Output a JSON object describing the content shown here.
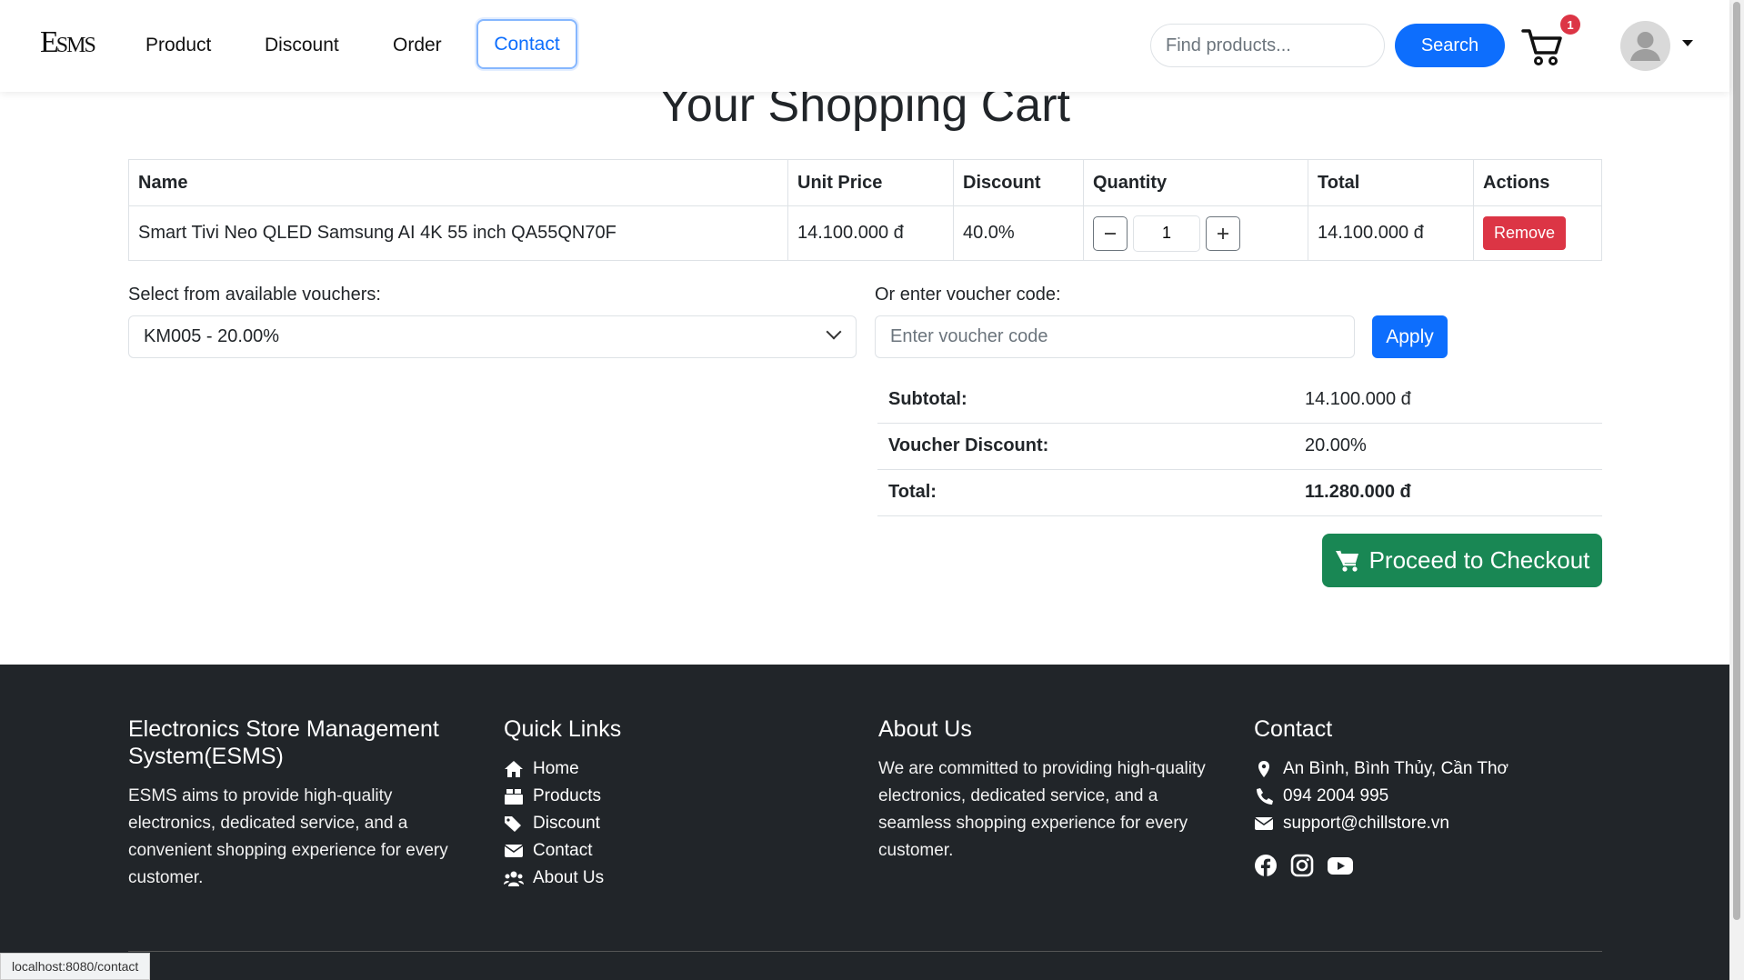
{
  "navbar": {
    "logo": "ESMS",
    "links": [
      "Product",
      "Discount",
      "Order",
      "Contact"
    ],
    "search_placeholder": "Find products...",
    "search_label": "Search",
    "cart_count": "1"
  },
  "cart": {
    "title": "Your Shopping Cart",
    "columns": [
      "Name",
      "Unit Price",
      "Discount",
      "Quantity",
      "Total",
      "Actions"
    ],
    "items": [
      {
        "name": "Smart Tivi Neo QLED Samsung AI 4K 55 inch QA55QN70F",
        "unit_price": "14.100.000 đ",
        "discount": "40.0%",
        "quantity": "1",
        "total": "14.100.000 đ",
        "remove_label": "Remove"
      }
    ]
  },
  "voucher": {
    "select_label": "Select from available vouchers:",
    "selected": "KM005 - 20.00%",
    "code_label": "Or enter voucher code:",
    "code_placeholder": "Enter voucher code",
    "apply_label": "Apply"
  },
  "summary": {
    "subtotal_label": "Subtotal:",
    "subtotal": "14.100.000 đ",
    "voucher_discount_label": "Voucher Discount:",
    "voucher_discount": "20.00%",
    "total_label": "Total:",
    "total": "11.280.000 đ"
  },
  "checkout_label": "Proceed to Checkout",
  "footer": {
    "about_title": "Electronics Store Management System(ESMS)",
    "about_text": "ESMS aims to provide high-quality electronics, dedicated service, and a convenient shopping experience for every customer.",
    "quick_links_title": "Quick Links",
    "quick_links": [
      "Home",
      "Products",
      "Discount",
      "Contact",
      "About Us"
    ],
    "about_us_title": "About Us",
    "about_us_text": "We are committed to providing high-quality electronics, dedicated service, and a seamless shopping experience for every customer.",
    "contact_title": "Contact",
    "address": "An Bình, Bình Thủy, Cần Thơ",
    "phone": "094 2004 995",
    "email": "support@chillstore.vn"
  },
  "status_url": "localhost:8080/contact",
  "colors": {
    "primary": "#0d6efd",
    "danger": "#dc3545",
    "success": "#198754",
    "footer_bg": "#212529"
  }
}
